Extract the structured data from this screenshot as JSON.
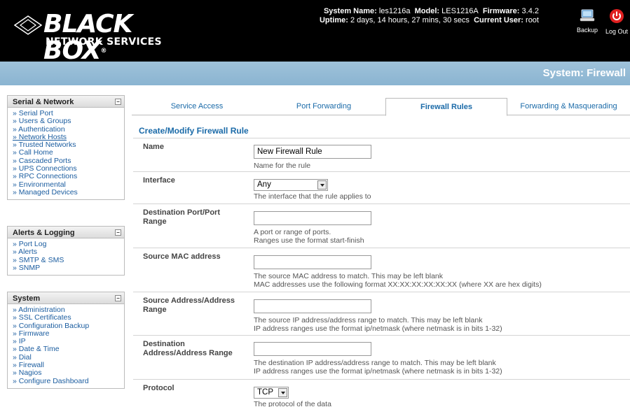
{
  "header": {
    "brand": "BLACK BOX",
    "brand_mark": "®",
    "brand_sub": "NETWORK SERVICES",
    "system_name_label": "System Name:",
    "system_name": "les1216a",
    "model_label": "Model:",
    "model": "LES1216A",
    "firmware_label": "Firmware:",
    "firmware": "3.4.2",
    "uptime_label": "Uptime:",
    "uptime": "2 days, 14 hours, 27 mins, 30 secs",
    "user_label": "Current User:",
    "user": "root",
    "backup_label": "Backup",
    "logout_label": "Log Out"
  },
  "page_title": "System: Firewall",
  "sidebar": {
    "serial_network": {
      "title": "Serial & Network",
      "items": [
        "» Serial Port",
        "» Users & Groups",
        "» Authentication",
        "» Network Hosts",
        "» Trusted Networks",
        "» Call Home",
        "» Cascaded Ports",
        "» UPS Connections",
        "» RPC Connections",
        "» Environmental",
        "» Managed Devices"
      ]
    },
    "alerts_logging": {
      "title": "Alerts & Logging",
      "items": [
        "» Port Log",
        "» Alerts",
        "» SMTP & SMS",
        "» SNMP"
      ]
    },
    "system": {
      "title": "System",
      "items": [
        "» Administration",
        "» SSL Certificates",
        "» Configuration Backup",
        "» Firmware",
        "» IP",
        "» Date & Time",
        "» Dial",
        "» Firewall",
        "» Nagios",
        "» Configure Dashboard"
      ]
    }
  },
  "tabs": [
    "Service Access",
    "Port Forwarding",
    "Firewall Rules",
    "Forwarding & Masquerading"
  ],
  "form": {
    "title": "Create/Modify Firewall Rule",
    "name": {
      "label": "Name",
      "value": "New Firewall Rule",
      "help": "Name for the rule"
    },
    "interface": {
      "label": "Interface",
      "value": "Any",
      "help": "The interface that the rule applies to"
    },
    "dest_port": {
      "label": "Destination Port/Port Range",
      "value": "",
      "help1": "A port or range of ports.",
      "help2": "Ranges use the format start-finish"
    },
    "src_mac": {
      "label": "Source MAC address",
      "value": "",
      "help1": "The source MAC address to match. This may be left blank",
      "help2": "MAC addresses use the following format XX:XX:XX:XX:XX:XX (where XX are hex digits)"
    },
    "src_addr": {
      "label": "Source Address/Address Range",
      "value": "",
      "help1": "The source IP address/address range to match. This may be left blank",
      "help2": "IP address ranges use the format ip/netmask (where netmask is in bits 1-32)"
    },
    "dest_addr": {
      "label": "Destination Address/Address Range",
      "value": "",
      "help1": "The destination IP address/address range to match. This may be left blank",
      "help2": "IP address ranges use the format ip/netmask (where netmask is in bits 1-32)"
    },
    "protocol": {
      "label": "Protocol",
      "value": "TCP",
      "help": "The protocol of the data"
    }
  }
}
